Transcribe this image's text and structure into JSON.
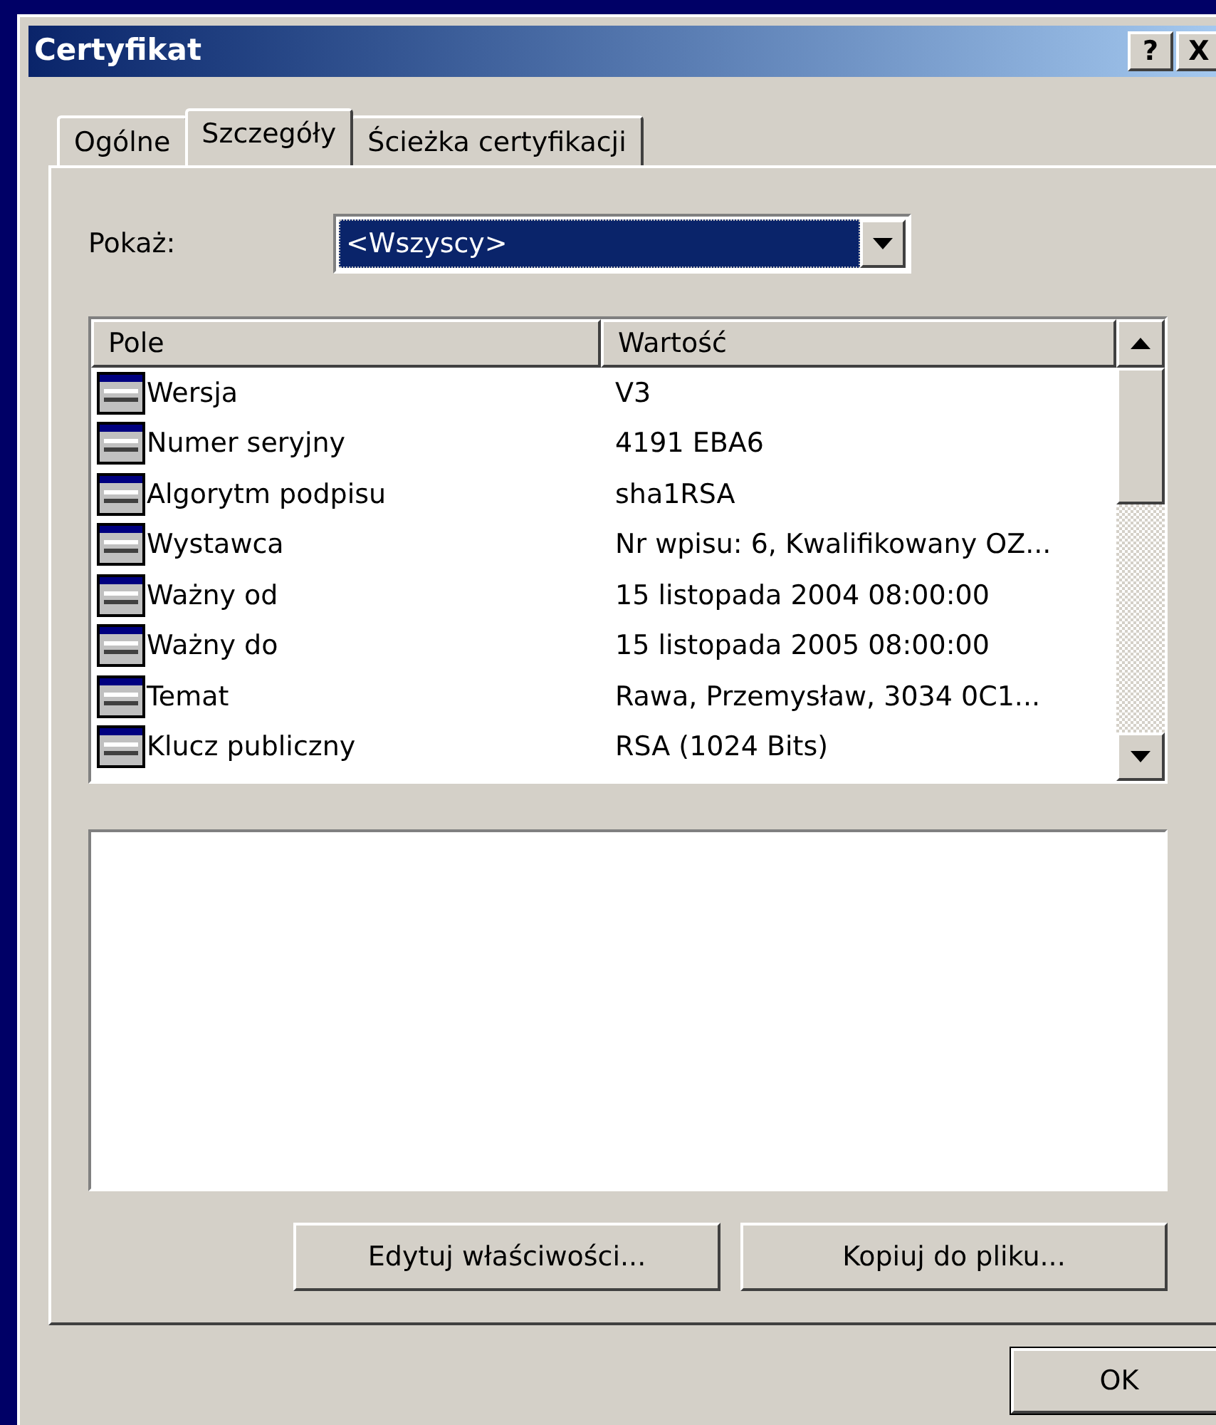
{
  "window": {
    "title": "Certyfikat",
    "title_buttons": [
      "?",
      "X"
    ]
  },
  "tabs": [
    {
      "label": "Ogólne",
      "selected": false
    },
    {
      "label": "Szczegóły",
      "selected": true
    },
    {
      "label": "Ścieżka certyfikacji",
      "selected": false
    }
  ],
  "show": {
    "label": "Pokaż:",
    "value": "<Wszyscy>"
  },
  "table": {
    "columns": [
      "Pole",
      "Wartość"
    ],
    "rows": [
      {
        "field": "Wersja",
        "value": "V3"
      },
      {
        "field": "Numer seryjny",
        "value": "4191 EBA6"
      },
      {
        "field": "Algorytm podpisu",
        "value": "sha1RSA"
      },
      {
        "field": "Wystawca",
        "value": "Nr wpisu: 6, Kwalifikowany OZ..."
      },
      {
        "field": "Ważny od",
        "value": "15 listopada 2004 08:00:00"
      },
      {
        "field": "Ważny do",
        "value": "15 listopada 2005 08:00:00"
      },
      {
        "field": "Temat",
        "value": "Rawa, Przemysław, 3034 0C1..."
      },
      {
        "field": "Klucz publiczny",
        "value": "RSA (1024 Bits)"
      }
    ]
  },
  "buttons": [
    "Edytuj właściwości...",
    "Kopiuj do pliku..."
  ],
  "footer_buttons": [
    "OK"
  ]
}
